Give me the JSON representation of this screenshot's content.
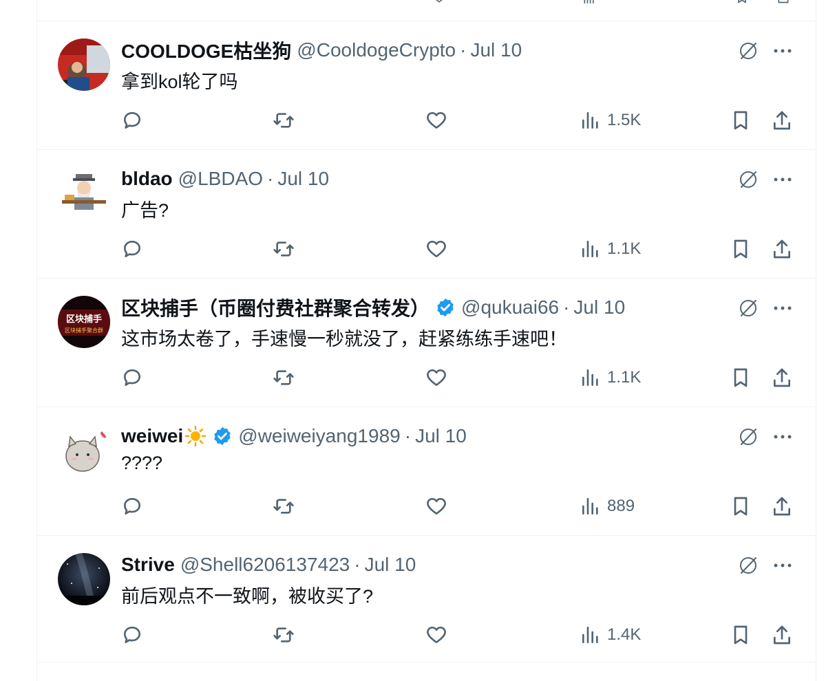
{
  "theme": {
    "verified_color": "#1d9bf0",
    "muted_color": "#536471",
    "text_color": "#0f1419"
  },
  "tweets": [
    {
      "name": "COOLDOGE枯坐狗",
      "handle": "@CooldogeCrypto",
      "separator": "·",
      "date": "Jul 10",
      "text": "拿到kol轮了吗",
      "views": "1.5K",
      "verified": false
    },
    {
      "name": "bldao",
      "handle": "@LBDAO",
      "separator": "·",
      "date": "Jul 10",
      "text": "广告?",
      "views": "1.1K",
      "verified": false
    },
    {
      "name": "区块捕手（币圈付费社群聚合转发）",
      "handle": "@qukuai66",
      "separator": "·",
      "date": "Jul 10",
      "text": "这市场太卷了，手速慢一秒就没了，赶紧练练手速吧！",
      "views": "1.1K",
      "verified": true,
      "avatar_text": [
        "区块捕手",
        "区块捕手聚合群"
      ]
    },
    {
      "name": "weiwei",
      "handle": "@weiweiyang1989",
      "separator": "·",
      "date": "Jul 10",
      "text": "????",
      "views": "889",
      "verified": true
    },
    {
      "name": "Strive",
      "handle": "@Shell6206137423",
      "separator": "·",
      "date": "Jul 10",
      "text": "前后观点不一致啊，被收买了?",
      "views": "1.4K",
      "verified": false
    }
  ],
  "icons": {
    "reply": "reply-icon",
    "retweet": "retweet-icon",
    "like": "heart-icon",
    "views": "views-chart-icon",
    "bookmark": "bookmark-icon",
    "share": "share-icon",
    "grok": "grok-icon",
    "more": "more-dots-icon",
    "verified": "verified-badge-icon",
    "sun_emoji": "sun-emoji-icon"
  }
}
